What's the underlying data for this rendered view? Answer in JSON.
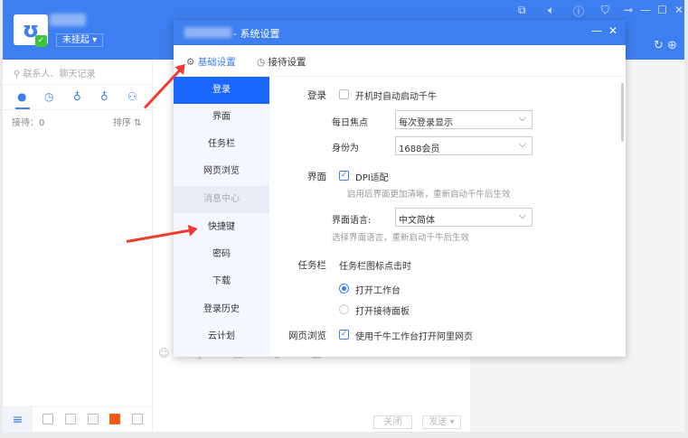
{
  "main": {
    "status": "未挂起 ▾",
    "search_placeholder": "联系人、聊天记录",
    "reception": "接待：0",
    "sort": "排序 ⇅",
    "close_button": "关闭",
    "send_button": "发送 ▾"
  },
  "dialog": {
    "title": "- 系统设置",
    "tabs": [
      "基础设置",
      "接待设置"
    ],
    "nav": [
      "登录",
      "界面",
      "任务栏",
      "网页浏览",
      "消息中心",
      "快捷键",
      "密码",
      "下载",
      "登录历史",
      "云计划"
    ],
    "login": {
      "section": "登录",
      "autostart": "开机时自动启动千牛",
      "daily_focus_label": "每日焦点",
      "daily_focus_value": "每次登录显示",
      "identity_label": "身份为",
      "identity_value": "1688会员"
    },
    "ui": {
      "section": "界面",
      "dpi": "DPI适配",
      "dpi_hint": "启用后界面更加清晰，重新启动千牛后生效",
      "lang_label": "界面语言:",
      "lang_value": "中文简体",
      "lang_hint": "选择界面语言，重新启动千牛后生效"
    },
    "taskbar": {
      "section": "任务栏",
      "desc": "任务栏图标点击时",
      "opt1": "打开工作台",
      "opt2": "打开接待面板"
    },
    "web": {
      "section": "网页浏览",
      "option": "使用千牛工作台打开阿里网页"
    }
  },
  "colors": {
    "accent": "#3d7ff0",
    "active_nav": "#1a66ff",
    "arrow": "#f03a2e"
  }
}
